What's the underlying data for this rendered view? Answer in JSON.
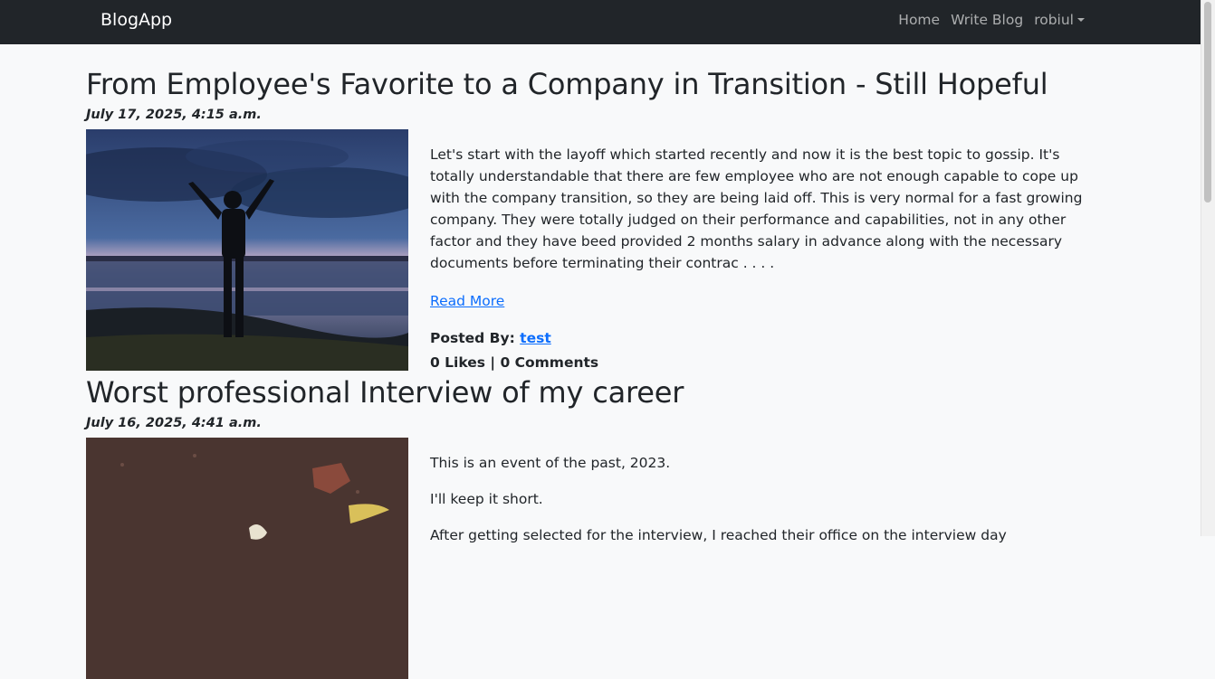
{
  "navbar": {
    "brand": "BlogApp",
    "home": "Home",
    "write_blog": "Write Blog",
    "user": "robiul"
  },
  "posts": [
    {
      "title": "From Employee's Favorite to a Company in Transition - Still Hopeful",
      "date": "July 17, 2025, 4:15 a.m.",
      "excerpt": "Let's start with the layoff which started recently and now it is the best topic to gossip. It's totally understandable that there are few employee who are not enough capable to cope up with the company transition, so they are being laid off. This is very normal for a fast growing company. They were totally judged on their performance and capabilities, not in any other factor and they have beed provided 2 months salary in advance along with the necessary documents before terminating their contrac . . . .",
      "read_more": "Read More",
      "posted_by_label": "Posted By:",
      "author": "test",
      "stats": "0 Likes | 0 Comments"
    },
    {
      "title": "Worst professional Interview of my career",
      "date": "July 16, 2025, 4:41 a.m.",
      "para1": "This is an event of the past, 2023.",
      "para2": "I'll keep it short.",
      "para3": "After getting selected for the interview, I reached their office on the interview day"
    }
  ]
}
